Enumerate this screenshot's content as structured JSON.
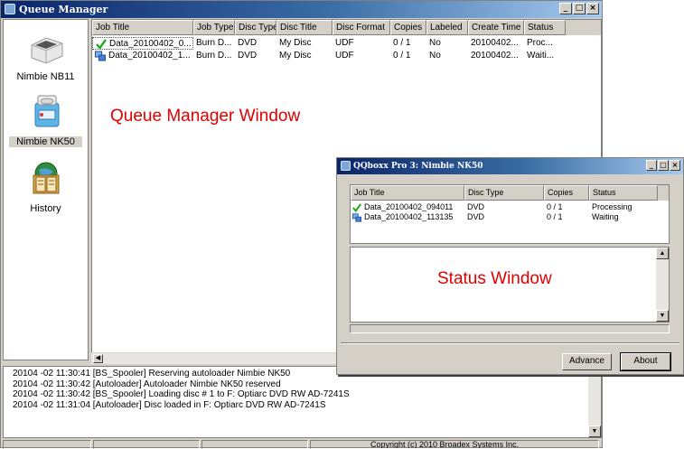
{
  "queue_manager": {
    "title": "Queue Manager",
    "window_buttons": [
      "_",
      "□",
      "×"
    ],
    "sidebar": [
      {
        "label": "Nimbie NB11",
        "icon": "printer-device-icon"
      },
      {
        "label": "Nimbie NK50",
        "icon": "autoloader-device-icon",
        "selected": true
      },
      {
        "label": "History",
        "icon": "history-book-icon"
      }
    ],
    "columns": [
      "Job Title",
      "Job Type",
      "Disc Type",
      "Disc Title",
      "Disc Format",
      "Copies",
      "Labeled",
      "Create Time",
      "Status"
    ],
    "rows": [
      {
        "icon": "checkmark-icon",
        "cells": [
          "Data_20100402_0...",
          "Burn D...",
          "DVD",
          "My Disc",
          "UDF",
          "0 / 1",
          "No",
          "20100402...",
          "Proc..."
        ]
      },
      {
        "icon": "queue-waiting-icon",
        "cells": [
          "Data_20100402_1...",
          "Burn D...",
          "DVD",
          "My Disc",
          "UDF",
          "0 / 1",
          "No",
          "20100402...",
          "Waiti..."
        ]
      }
    ],
    "log": [
      "20104 -02 11:30:41 [BS_Spooler] Reserving autoloader Nimbie NK50",
      "20104 -02 11:30:42 [Autoloader] Autoloader Nimbie NK50 reserved",
      "20104 -02 11:30:42 [BS_Spooler] Loading disc # 1 to F: Optiarc DVD RW AD-7241S",
      "20104 -02 11:31:04 [Autoloader] Disc loaded in F: Optiarc DVD RW AD-7241S"
    ],
    "copyright": "Copyright (c) 2010 Broadex Systems Inc.",
    "annotation": "Queue Manager Window"
  },
  "status_window": {
    "title": "QQboxx Pro 3: Nimbie NK50",
    "window_buttons": [
      "_",
      "□",
      "×"
    ],
    "columns": [
      "Job Title",
      "Disc Type",
      "Copies",
      "Status"
    ],
    "rows": [
      {
        "icon": "checkmark-icon",
        "cells": [
          "Data_20100402_094011",
          "DVD",
          "0 / 1",
          "Processing"
        ]
      },
      {
        "icon": "queue-waiting-icon",
        "cells": [
          "Data_20100402_113135",
          "DVD",
          "0 / 1",
          "Waiting"
        ]
      }
    ],
    "buttons": {
      "advance": "Advance",
      "about": "About"
    },
    "annotation": "Status Window"
  },
  "colors": {
    "annotation": "#e20000",
    "titlebar_start": "#0a246a",
    "titlebar_end": "#a6caf0",
    "check": "#22aa22"
  }
}
